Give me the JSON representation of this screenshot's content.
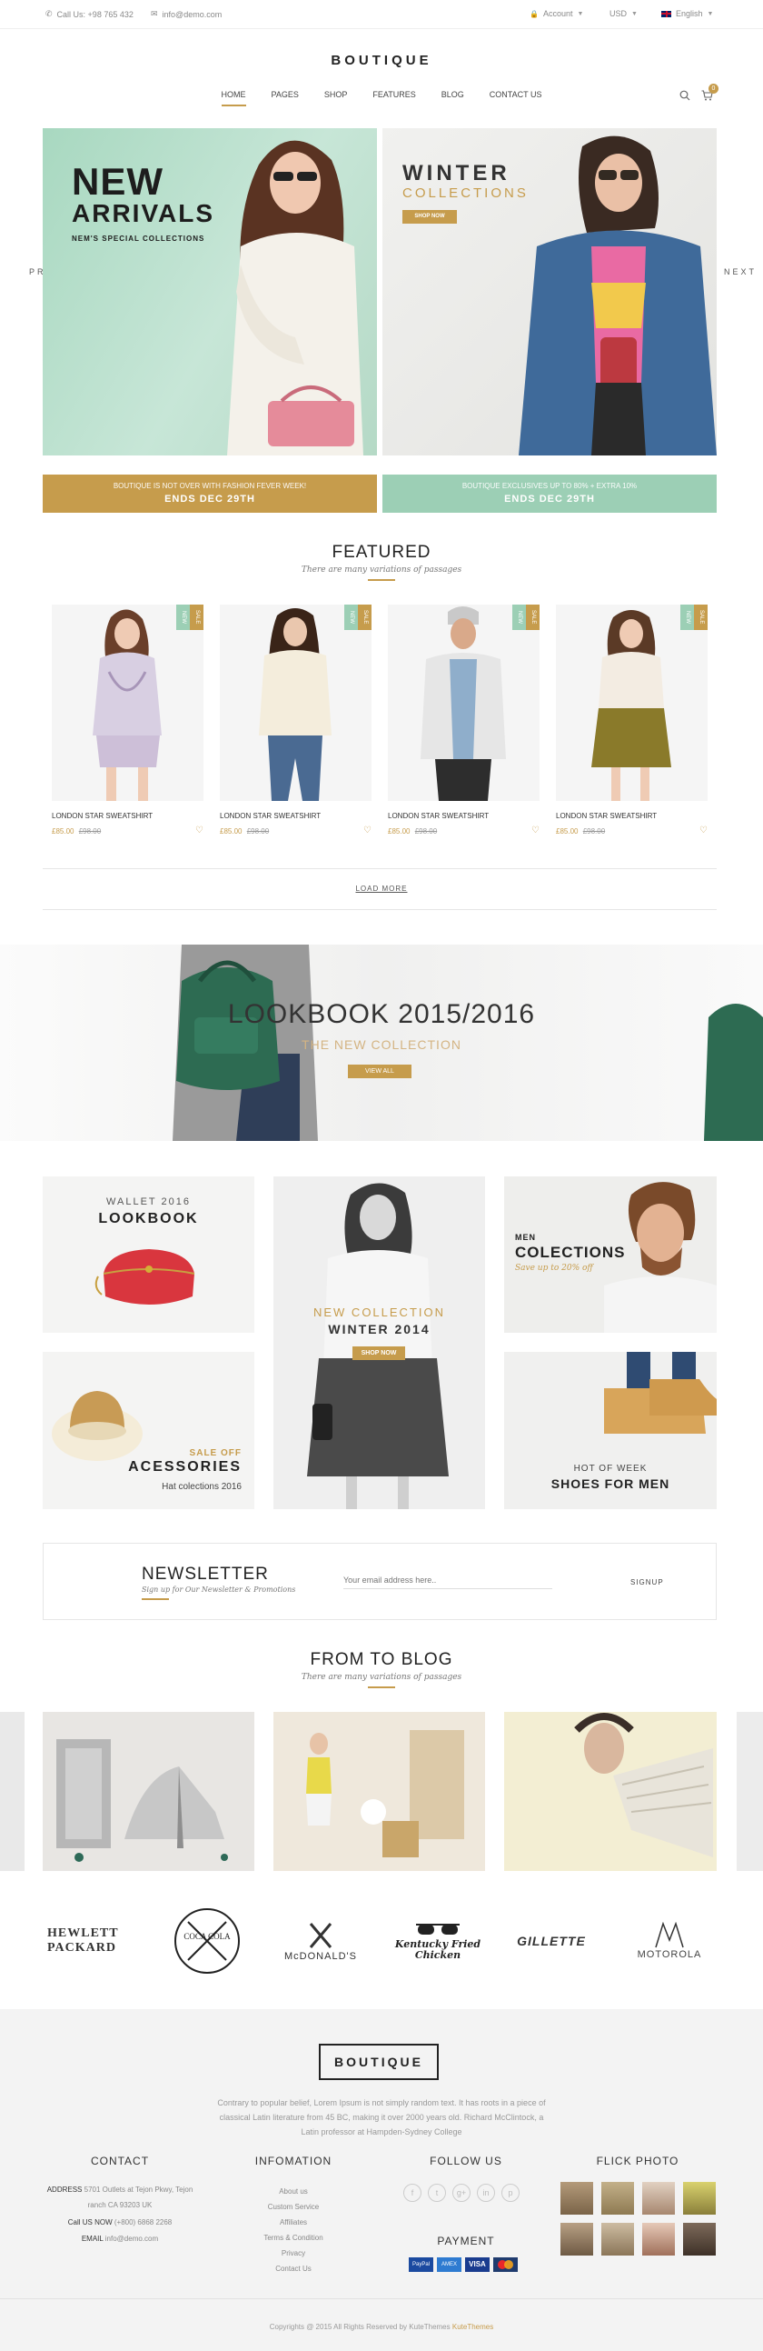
{
  "topbar": {
    "phone": "Call Us: +98 765 432",
    "email": "info@demo.com",
    "account": "Account",
    "currency": "USD",
    "language": "English"
  },
  "logo": "BOUTIQUE",
  "nav": {
    "items": [
      "HOME",
      "PAGES",
      "SHOP",
      "FEATURES",
      "BLOG",
      "CONTACT US"
    ],
    "active": "HOME",
    "cart_count": "0"
  },
  "hero": {
    "left_title1": "NEW",
    "left_title2": "ARRIVALS",
    "left_sub": "NEM'S SPECIAL COLLECTIONS",
    "right_title1": "WINTER",
    "right_title2": "COLLECTIONS",
    "right_button": "SHOP NOW",
    "prev": "PREV",
    "next": "NEXT"
  },
  "ribbons": [
    {
      "line1": "BOUTIQUE IS NOT OVER WITH FASHION FEVER WEEK!",
      "line2": "ENDS DEC 29TH",
      "color": "#c69c4c"
    },
    {
      "line1": "BOUTIQUE EXCLUSIVES UP TO 80% + EXTRA 10%",
      "line2": "ENDS DEC 29TH",
      "color": "#9ccfb5"
    }
  ],
  "featured": {
    "title": "FEATURED",
    "subtitle": "There are many variations of passages",
    "products": [
      {
        "name": "LONDON STAR SWEATSHIRT",
        "price": "£85.00",
        "old_price": "£98.00",
        "badges": [
          "NEW",
          "SALE"
        ]
      },
      {
        "name": "LONDON STAR SWEATSHIRT",
        "price": "£85.00",
        "old_price": "£98.00",
        "badges": [
          "NEW",
          "SALE"
        ]
      },
      {
        "name": "LONDON STAR SWEATSHIRT",
        "price": "£85.00",
        "old_price": "£98.00",
        "badges": [
          "NEW",
          "SALE"
        ]
      },
      {
        "name": "LONDON STAR SWEATSHIRT",
        "price": "£85.00",
        "old_price": "£98.00",
        "badges": [
          "NEW",
          "SALE"
        ]
      }
    ],
    "load_more": "LOAD MORE"
  },
  "lookbook": {
    "title": "LOOKBOOK 2015/2016",
    "subtitle": "THE NEW COLLECTION",
    "button": "VIEW ALL"
  },
  "collections": {
    "wallet_top": "WALLET 2016",
    "wallet_bottom": "LOOKBOOK",
    "center_top": "NEW COLLECTION",
    "center_mid": "WINTER 2014",
    "center_btn": "SHOP NOW",
    "men_top": "MEN",
    "men_mid": "COLECTIONS",
    "men_sub": "Save up to 20% off",
    "acc_top": "SALE OFF",
    "acc_mid": "ACESSORIES",
    "acc_sub": "Hat colections 2016",
    "shoes_top": "HOT OF WEEK",
    "shoes_mid": "SHOES FOR MEN"
  },
  "newsletter": {
    "title": "NEWSLETTER",
    "subtitle": "Sign up for Our Newsletter & Promotions",
    "placeholder": "Your email address here..",
    "button": "SIGNUP"
  },
  "blog": {
    "title": "FROM TO BLOG",
    "subtitle": "There are many variations of passages"
  },
  "brands": [
    "HEWLETT PACKARD",
    "COCA COLA",
    "McDONALD'S",
    "Kentucky Fried Chicken",
    "GILLETTE",
    "MOTOROLA"
  ],
  "footer": {
    "logo": "BOUTIQUE",
    "about": "Contrary to popular belief, Lorem Ipsum is not simply random text. It has roots in a piece of classical Latin literature from 45 BC, making it over 2000 years old. Richard McClintock, a Latin professor at Hampden-Sydney College",
    "contact_title": "CONTACT",
    "address_label": "ADDRESS",
    "address": "5701 Outlets at Tejon Pkwy, Tejon ranch CA 93203 UK",
    "call_label": "Call US NOW",
    "call": "(+800) 6868 2268",
    "email_label": "EMAIL",
    "email": "info@demo.com",
    "info_title": "INFOMATION",
    "info_links": [
      "About us",
      "Custom Service",
      "Affiliates",
      "Terms & Condition",
      "Privacy",
      "Contact Us"
    ],
    "follow_title": "FOLLOW US",
    "social": [
      "f",
      "t",
      "g+",
      "in",
      "p"
    ],
    "payment_title": "PAYMENT",
    "payments": [
      "PayPal",
      "AMEX",
      "VISA",
      "MC"
    ],
    "flick_title": "FLICK PHOTO",
    "copyright": "Copyrights @ 2015 All Rights Reserved by KuteThemes",
    "copyright_link": "KuteThemes"
  }
}
